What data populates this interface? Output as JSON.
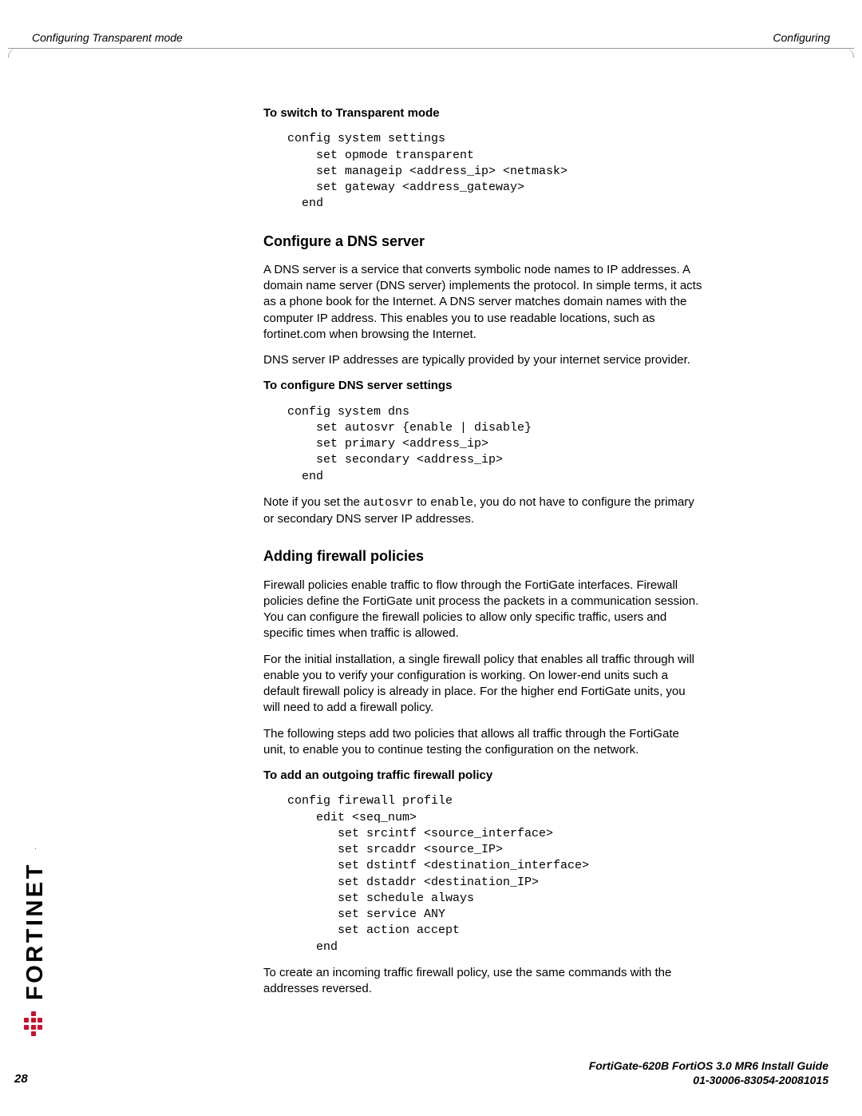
{
  "header": {
    "left": "Configuring Transparent mode",
    "right": "Configuring"
  },
  "sections": {
    "s1_heading": "To switch to Transparent mode",
    "s1_code": "config system settings\n    set opmode transparent\n    set manageip <address_ip> <netmask>\n    set gateway <address_gateway>\n  end",
    "s2_title": "Configure a DNS server",
    "s2_p1": "A DNS server is a service that converts symbolic node names to IP addresses. A domain name server (DNS server) implements the protocol. In simple terms, it acts as a phone book for the Internet. A DNS server matches domain names with the computer IP address. This enables you to use readable locations, such as fortinet.com when browsing the Internet.",
    "s2_p2": "DNS server IP addresses are typically provided by your internet service provider.",
    "s2_sub": "To configure DNS server settings",
    "s2_code": "config system dns\n    set autosvr {enable | disable}\n    set primary <address_ip>\n    set secondary <address_ip>\n  end",
    "s2_note_pre": "Note if you set the ",
    "s2_note_c1": "autosvr",
    "s2_note_mid": " to ",
    "s2_note_c2": "enable",
    "s2_note_post": ", you do not have to configure the primary or secondary DNS server IP addresses.",
    "s3_title": "Adding firewall policies",
    "s3_p1": "Firewall policies enable traffic to flow through the FortiGate interfaces. Firewall policies define the FortiGate unit process the packets in a communication session. You can configure the firewall policies to allow only specific traffic, users and specific times when traffic is allowed.",
    "s3_p2": "For the initial installation, a single firewall policy that enables all traffic through will enable you to verify your configuration is working. On lower-end units such a default firewall policy is already in place. For the higher end FortiGate units, you will need to add a firewall policy.",
    "s3_p3": "The following steps add two policies that allows all traffic through the FortiGate unit, to enable you to continue testing the configuration on the network.",
    "s3_sub": "To add an outgoing traffic firewall policy",
    "s3_code": "config firewall profile\n    edit <seq_num>\n       set srcintf <source_interface>\n       set srcaddr <source_IP>\n       set dstintf <destination_interface>\n       set dstaddr <destination_IP>\n       set schedule always\n       set service ANY\n       set action accept\n    end",
    "s3_p4": "To create an incoming traffic firewall policy, use the same commands with the addresses reversed."
  },
  "footer": {
    "line1": "FortiGate-620B FortiOS 3.0 MR6 Install Guide",
    "line2": "01-30006-83054-20081015",
    "page": "28"
  },
  "logo": {
    "text": "FORTINET",
    "tm": "."
  }
}
